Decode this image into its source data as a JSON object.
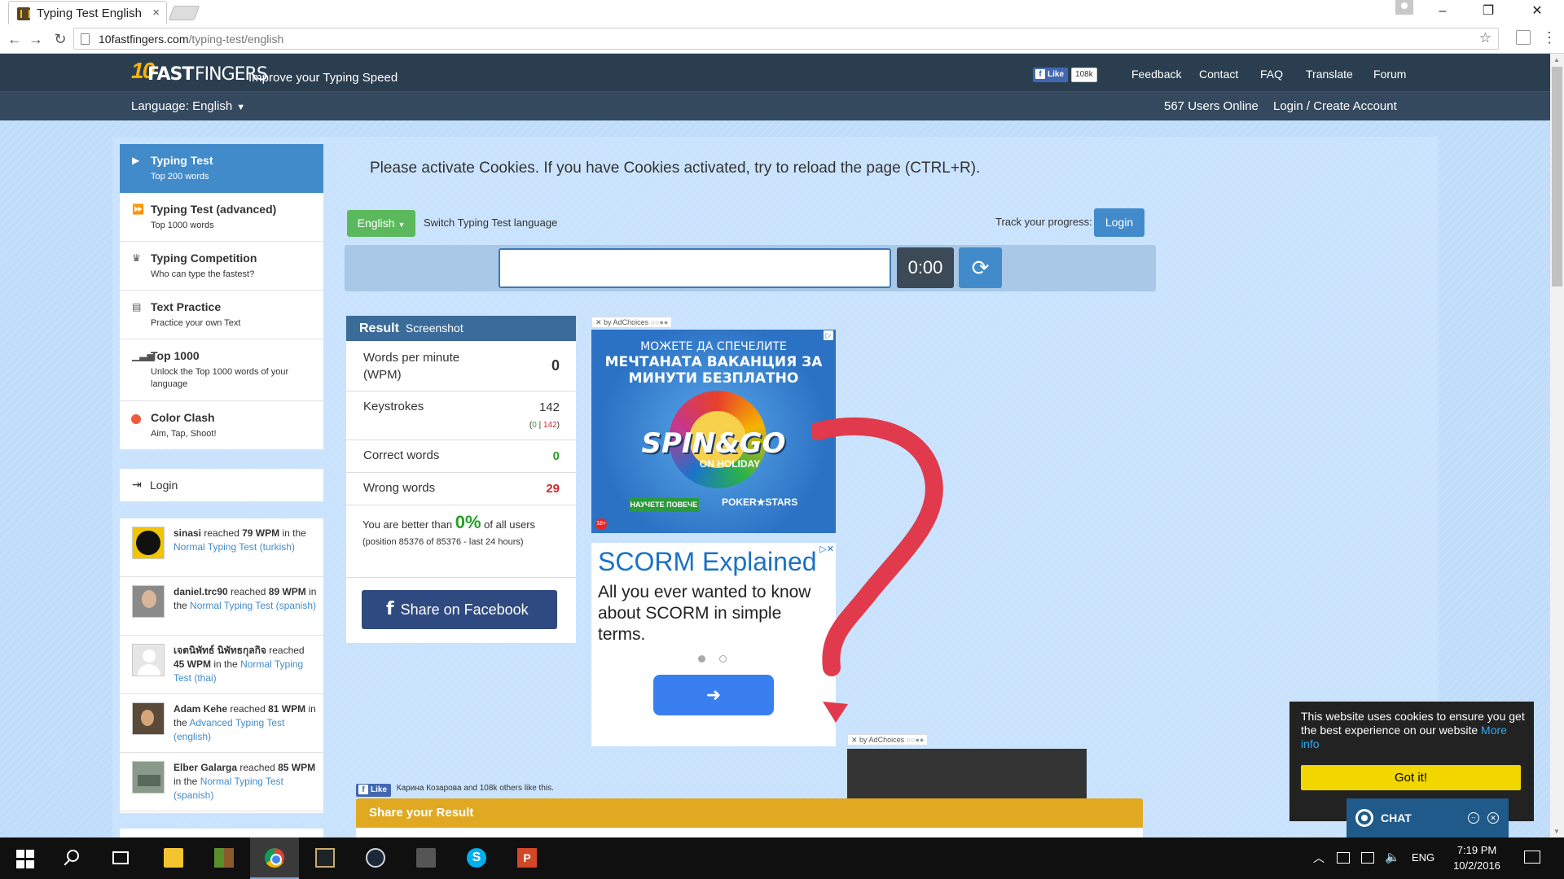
{
  "browser": {
    "tab_title": "Typing Test English",
    "tab_close": "×",
    "url_domain": "10fastfingers.com",
    "url_path": "/typing-test/english",
    "window_buttons": {
      "minimize": "–",
      "maximize": "❐",
      "close": "✕"
    }
  },
  "header": {
    "logo_10": "10",
    "logo_fast": "FAST",
    "logo_fingers": "FINGERS",
    "tagline": "Improve your Typing Speed",
    "fb_like": "Like",
    "fb_count": "108k",
    "nav": [
      "Feedback",
      "Contact",
      "FAQ",
      "Translate",
      "Forum"
    ],
    "language_label": "Language: English",
    "users_online": "567 Users Online",
    "login_create": "Login / Create Account"
  },
  "sidebar": {
    "items": [
      {
        "title": "Typing Test",
        "sub": "Top 200 words",
        "icon": "play-icon"
      },
      {
        "title": "Typing Test (advanced)",
        "sub": "Top 1000 words",
        "icon": "fast-forward-icon"
      },
      {
        "title": "Typing Competition",
        "sub": "Who can type the fastest?",
        "icon": "trophy-icon"
      },
      {
        "title": "Text Practice",
        "sub": "Practice your own Text",
        "icon": "document-icon"
      },
      {
        "title": "Top 1000",
        "sub": "Unlock the Top 1000 words of your language",
        "icon": "bar-chart-icon"
      },
      {
        "title": "Color Clash",
        "sub": "Aim, Tap, Shoot!",
        "icon": "color-dot-icon"
      }
    ],
    "login": "Login"
  },
  "activity": [
    {
      "name": "sinasi",
      "reached": "reached",
      "wpm": "79 WPM",
      "in": "in the",
      "test": "Normal Typing Test (turkish)"
    },
    {
      "name": "daniel.trc90",
      "reached": "reached",
      "wpm": "89 WPM",
      "in": "in the",
      "test": "Normal Typing Test (spanish)"
    },
    {
      "name": "เจตนิพัทธ์ นิพัทธกุลกิจ",
      "reached": "reached",
      "wpm": "45 WPM",
      "in": "in the",
      "test": "Normal Typing Test (thai)"
    },
    {
      "name": "Adam Kehe",
      "reached": "reached",
      "wpm": "81 WPM",
      "in": "in the",
      "test": "Advanced Typing Test (english)"
    },
    {
      "name": "Elber Galarga",
      "reached": "reached",
      "wpm": "85 WPM",
      "in": "in the",
      "test": "Normal Typing Test (spanish)"
    }
  ],
  "main": {
    "cookie_message": "Please activate Cookies. If you have Cookies activated, try to reload the page (CTRL+R).",
    "language_button": "English",
    "switch_language": "Switch Typing Test language",
    "track_progress": "Track your progress:",
    "login_button": "Login",
    "typing_value": "",
    "timer": "0:00",
    "reload_glyph": "⟳"
  },
  "result": {
    "title": "Result",
    "screenshot": "Screenshot",
    "wpm_label": "Words per minute (WPM)",
    "wpm_value": "0",
    "keystrokes_label": "Keystrokes",
    "keystrokes_value": "142",
    "keystrokes_correct": "0",
    "keystrokes_sep": "|",
    "keystrokes_wrong": "142",
    "correct_label": "Correct words",
    "correct_value": "0",
    "wrong_label": "Wrong words",
    "wrong_value": "29",
    "better_prefix": "You are better than",
    "better_pct": "0%",
    "better_suffix": "of all users",
    "position_text": "(position 85376 of 85376 - last 24 hours)",
    "share_facebook": "Share on Facebook"
  },
  "ads": {
    "adchoices": "by AdChoices",
    "poker_line1": "МОЖЕТЕ ДА СПЕЧЕЛИТЕ",
    "poker_line2": "МЕЧТАНАТА ВАКАНЦИЯ ЗА МИНУТИ БЕЗПЛАТНО",
    "poker_brand": "SPIN&GO",
    "poker_brand2": "ON HOLIDAY",
    "poker_cta": "НАУЧЕТЕ ПОВЕЧЕ",
    "poker_stars": "POKER★STARS",
    "poker_age": "18+",
    "scorm_title": "SCORM Explained",
    "scorm_body": "All you ever wanted to know about SCORM in simple terms.",
    "scorm_arrow": "➜"
  },
  "share": {
    "fb_like_text": "Карина Козарова and 108k others like this.",
    "share_result_title": "Share your Result"
  },
  "cookie_notice": {
    "text": "This website uses cookies to ensure you get the best experience on our website",
    "more_info": "More info",
    "button": "Got it!"
  },
  "chat": {
    "label": "CHAT"
  },
  "taskbar": {
    "language": "ENG",
    "time": "7:19 PM",
    "date": "10/2/2016"
  },
  "colors": {
    "header": "#2b3e50",
    "page_bg": "#bfdcfa",
    "accent_blue": "#428bca",
    "green": "#5cb85c",
    "share_bar": "#e0a921",
    "cookie_yellow": "#f1d600"
  }
}
